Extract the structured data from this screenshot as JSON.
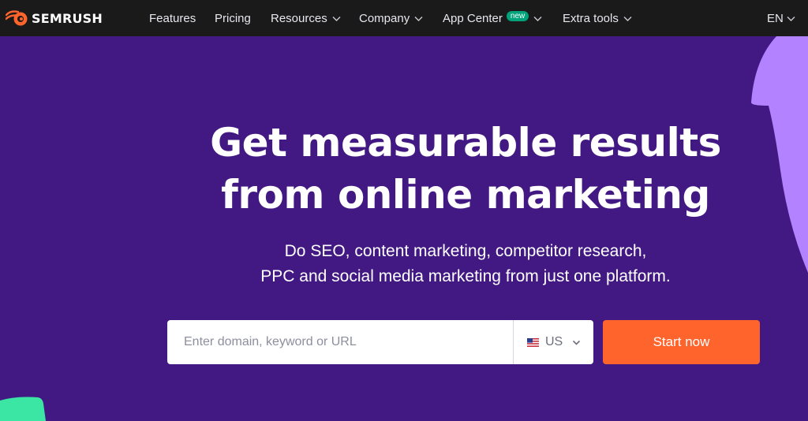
{
  "brand": {
    "name": "SEMRUSH"
  },
  "nav": {
    "items": [
      {
        "label": "Features",
        "has_dropdown": false
      },
      {
        "label": "Pricing",
        "has_dropdown": false
      },
      {
        "label": "Resources",
        "has_dropdown": true
      },
      {
        "label": "Company",
        "has_dropdown": true
      },
      {
        "label": "App Center",
        "has_dropdown": true,
        "badge": "new"
      },
      {
        "label": "Extra tools",
        "has_dropdown": true
      }
    ],
    "language": "EN"
  },
  "hero": {
    "title_line1": "Get measurable results",
    "title_line2": "from online marketing",
    "subtitle_line1": "Do SEO, content marketing, competitor research,",
    "subtitle_line2": "PPC and social media marketing from just one platform."
  },
  "search": {
    "placeholder": "Enter domain, keyword or URL",
    "value": "",
    "country": "US",
    "country_icon": "us-flag-icon",
    "button_label": "Start now"
  },
  "colors": {
    "hero_background": "#421983",
    "nav_background": "#1a1a1a",
    "accent_orange": "#ff642d",
    "badge_green": "#00a37a",
    "deco_lilac": "#b383ff",
    "deco_green": "#3be6a5"
  }
}
